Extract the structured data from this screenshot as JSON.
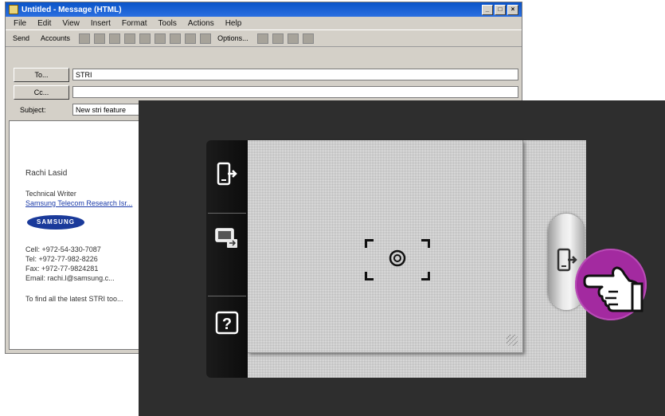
{
  "email_window": {
    "title": "Untitled - Message (HTML)",
    "menu": [
      "File",
      "Edit",
      "View",
      "Insert",
      "Format",
      "Tools",
      "Actions",
      "Help"
    ],
    "toolbar": {
      "send": "Send",
      "accounts": "Accounts",
      "options": "Options..."
    },
    "to_button": "To...",
    "cc_button": "Cc...",
    "subject_label": "Subject:",
    "to_value": "STRI",
    "cc_value": "",
    "subject_value": "New stri feature",
    "signature": {
      "name": "Rachi Lasid",
      "role": "Technical Writer",
      "company": "Samsung Telecom Research Isr...",
      "logo_text": "SAMSUNG",
      "cell": "Cell:   +972-54-330-7087",
      "tel": "Tel:    +972-77-982-8226",
      "fax": "Fax:   +972-77-9824281",
      "email": "Email:  rachi.l@samsung.c...",
      "footer": "To find all the latest STRI too..."
    }
  },
  "overlay": {
    "sidebar_buttons": [
      {
        "name": "exit-share-button",
        "icon": "phone-exit-icon"
      },
      {
        "name": "screen-switch-button",
        "icon": "screen-switch-icon"
      },
      {
        "name": "help-button",
        "icon": "help-icon",
        "label": "?"
      }
    ],
    "side_tab": {
      "icon": "phone-exit-icon"
    },
    "pointer": {
      "icon": "pointing-hand-icon",
      "highlight_color": "#a32aa0"
    }
  }
}
